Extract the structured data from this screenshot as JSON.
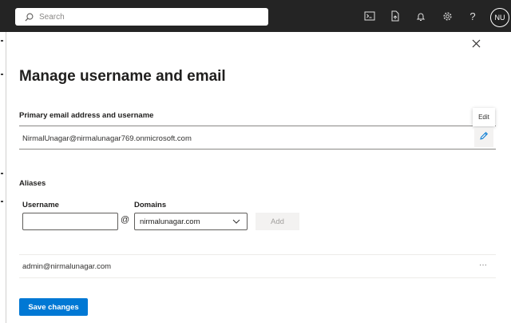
{
  "topbar": {
    "search_placeholder": "Search",
    "icons": [
      "terminal-icon",
      "document-icon",
      "bell-icon",
      "gear-icon",
      "help-icon"
    ],
    "avatar_initials": "NU"
  },
  "panel": {
    "title": "Manage username and email",
    "primary": {
      "label": "Primary email address and username",
      "email": "NirmalUnagar@nirmalunagar769.onmicrosoft.com",
      "edit_tooltip": "Edit"
    },
    "aliases": {
      "heading": "Aliases",
      "username_label": "Username",
      "domains_label": "Domains",
      "username_value": "",
      "at_symbol": "@",
      "domain_selected": "nirmalunagar.com",
      "add_label": "Add",
      "rows": [
        {
          "email": "admin@nirmalunagar.com",
          "more": "···"
        }
      ]
    },
    "save_label": "Save changes"
  },
  "colors": {
    "topbar_bg": "#242424",
    "accent": "#0078d4",
    "disabled_bg": "#f3f2f1",
    "disabled_text": "#a19f9d"
  }
}
